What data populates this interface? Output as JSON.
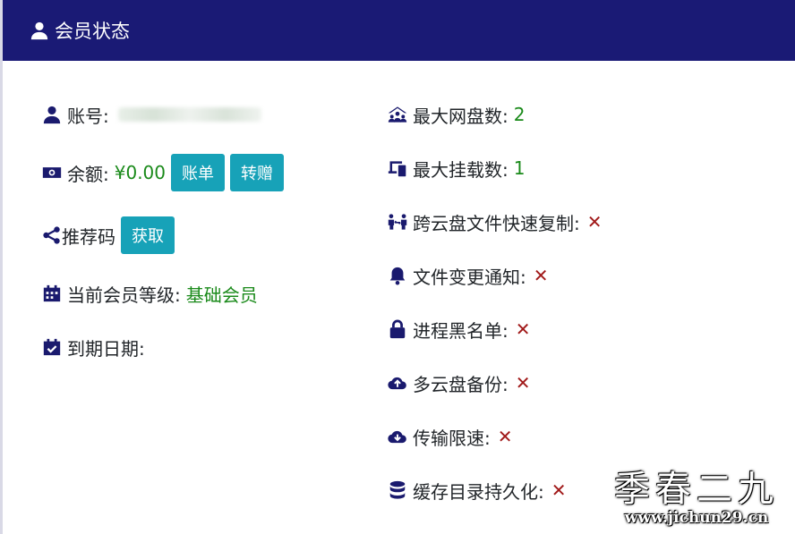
{
  "header": {
    "title": "会员状态",
    "icon": "user-icon"
  },
  "left": {
    "account": {
      "label": "账号:",
      "icon": "user-icon"
    },
    "balance": {
      "label": "余额:",
      "value": "¥0.00",
      "icon": "money-icon",
      "bill_button": "账单",
      "transfer_button": "转赠"
    },
    "referral": {
      "label": "推荐码",
      "icon": "share-icon",
      "get_button": "获取"
    },
    "level": {
      "label": "当前会员等级:",
      "value": "基础会员",
      "icon": "calendar-icon"
    },
    "expiry": {
      "label": "到期日期:",
      "icon": "calendar-check-icon"
    }
  },
  "right": {
    "max_drives": {
      "label": "最大网盘数:",
      "value": "2",
      "icon": "network-users-icon"
    },
    "max_mounts": {
      "label": "最大挂载数:",
      "value": "1",
      "icon": "devices-icon"
    },
    "cross_copy": {
      "label": "跨云盘文件快速复制:",
      "value": "✕",
      "icon": "people-arrows-icon"
    },
    "file_notify": {
      "label": "文件变更通知:",
      "value": "✕",
      "icon": "bell-icon"
    },
    "blacklist": {
      "label": "进程黑名单:",
      "value": "✕",
      "icon": "lock-icon"
    },
    "multi_backup": {
      "label": "多云盘备份:",
      "value": "✕",
      "icon": "cloud-upload-icon"
    },
    "speed_limit": {
      "label": "传输限速:",
      "value": "✕",
      "icon": "cloud-download-icon"
    },
    "cache_persist": {
      "label": "缓存目录持久化:",
      "value": "✕",
      "icon": "database-icon"
    }
  },
  "watermark": {
    "big": "季春二九",
    "small": "www.jichun29.cn"
  },
  "colors": {
    "header_bg": "#1a1a75",
    "button_bg": "#17a2b8",
    "green": "#1a8a1a",
    "red": "#a11a1a",
    "icon": "#1a1a6e"
  }
}
